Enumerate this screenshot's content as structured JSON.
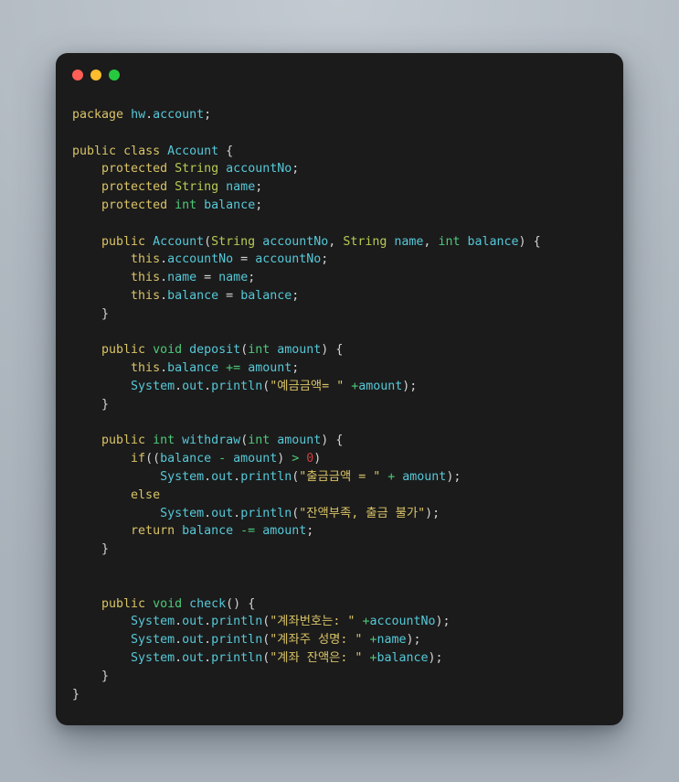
{
  "window": {
    "background_color": "#1b1b1b",
    "page_background_color": "#b2bac2",
    "controls": [
      {
        "name": "close",
        "label": "",
        "color": "#ff5f56"
      },
      {
        "name": "minimize",
        "label": "",
        "color": "#ffbd2e"
      },
      {
        "name": "maximize",
        "label": "",
        "color": "#27c93f"
      }
    ]
  },
  "theme": {
    "keyword": "#d9c367",
    "type": "#b5cc54",
    "primitive": "#4ec97a",
    "identifier": "#56c8d8",
    "string": "#d9c367",
    "number": "#c94040",
    "operator": "#4ec97a",
    "punctuation": "#d4d4d4"
  },
  "code": {
    "language": "java",
    "package": "hw.account",
    "class_name": "Account",
    "fields": [
      {
        "modifier": "protected",
        "type": "String",
        "name": "accountNo"
      },
      {
        "modifier": "protected",
        "type": "String",
        "name": "name"
      },
      {
        "modifier": "protected",
        "type": "int",
        "name": "balance"
      }
    ],
    "strings": [
      "예금금액= ",
      "출금금액 = ",
      "잔액부족, 출금 불가",
      "계좌번호는: ",
      "계좌주 성명: ",
      "계좌 잔액은: "
    ],
    "methods": [
      {
        "name": "Account",
        "return": "",
        "params": "String accountNo, String name, int balance"
      },
      {
        "name": "deposit",
        "return": "void",
        "params": "int amount"
      },
      {
        "name": "withdraw",
        "return": "int",
        "params": "int amount"
      },
      {
        "name": "check",
        "return": "void",
        "params": ""
      }
    ],
    "lines": [
      "package hw.account;",
      "",
      "public class Account {",
      "    protected String accountNo;",
      "    protected String name;",
      "    protected int balance;",
      "",
      "    public Account(String accountNo, String name, int balance) {",
      "        this.accountNo = accountNo;",
      "        this.name = name;",
      "        this.balance = balance;",
      "    }",
      "",
      "    public void deposit(int amount) {",
      "        this.balance += amount;",
      "        System.out.println(\"예금금액= \" +amount);",
      "    }",
      "",
      "    public int withdraw(int amount) {",
      "        if((balance - amount) > 0)",
      "            System.out.println(\"출금금액 = \" + amount);",
      "        else",
      "            System.out.println(\"잔액부족, 출금 불가\");",
      "        return balance -= amount;",
      "    }",
      "",
      "",
      "    public void check() {",
      "        System.out.println(\"계좌번호는: \" +accountNo);",
      "        System.out.println(\"계좌주 성명: \" +name);",
      "        System.out.println(\"계좌 잔액은: \" +balance);",
      "    }",
      "}"
    ]
  }
}
